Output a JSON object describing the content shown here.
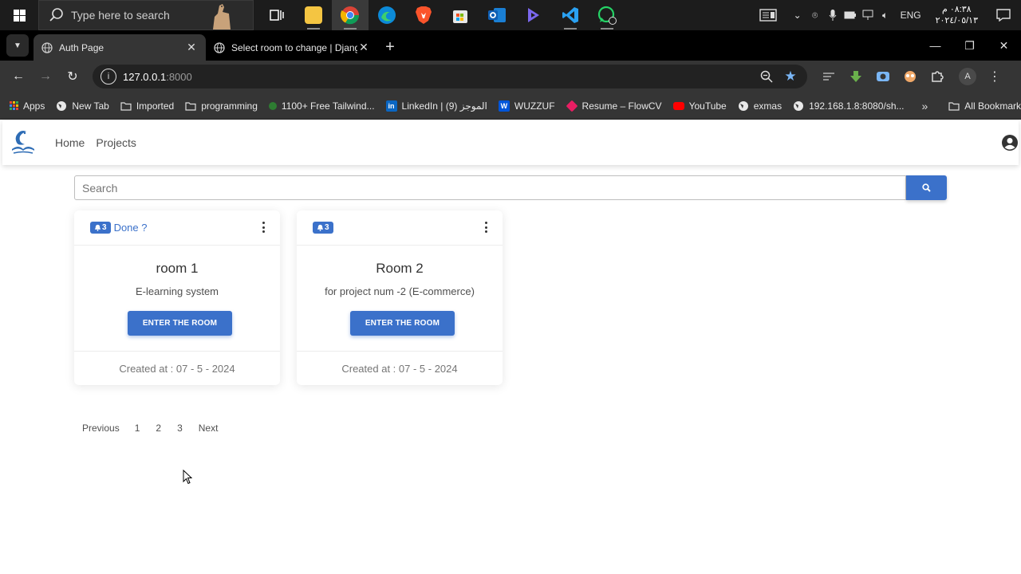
{
  "taskbar": {
    "search_placeholder": "Type here to search",
    "lang": "ENG",
    "time": "٠٨:٣٨ م",
    "date": "٢٠٢٤/٠٥/١٣"
  },
  "browser": {
    "tabs": [
      {
        "title": "Auth Page",
        "active": true
      },
      {
        "title": "Select room to change | Django",
        "active": false
      }
    ],
    "address": {
      "host": "127.0.0.1",
      "port": ":8000"
    },
    "profile_initial": "A",
    "bookmarks": [
      {
        "label": "Apps",
        "color": "#ea4335"
      },
      {
        "label": "New Tab",
        "color": "#e8e8e8"
      },
      {
        "label": "Imported",
        "color": "folder"
      },
      {
        "label": "programming",
        "color": "folder"
      },
      {
        "label": "1100+ Free Tailwind...",
        "color": "#2e7d32"
      },
      {
        "label": "LinkedIn | الموجز (9)",
        "color": "#0a66c2"
      },
      {
        "label": "WUZZUF",
        "color": "#0055d9"
      },
      {
        "label": "Resume – FlowCV",
        "color": "#e91e63"
      },
      {
        "label": "YouTube",
        "color": "#ff0000"
      },
      {
        "label": "exmas",
        "color": "#e8e8e8"
      },
      {
        "label": "192.168.1.8:8080/sh...",
        "color": "#e8e8e8"
      }
    ],
    "all_bookmarks": "All Bookmarks"
  },
  "navbar": {
    "links": [
      "Home",
      "Projects"
    ]
  },
  "search": {
    "placeholder": "Search"
  },
  "rooms": [
    {
      "badge": "3",
      "status": "Done ?",
      "title": "room 1",
      "description": "E-learning system",
      "button": "ENTER THE ROOM",
      "created": "Created at : 07 - 5 - 2024"
    },
    {
      "badge": "3",
      "status": "",
      "title": "Room 2",
      "description": "for project num -2 (E-commerce)",
      "button": "ENTER THE ROOM",
      "created": "Created at : 07 - 5 - 2024"
    }
  ],
  "pagination": {
    "previous": "Previous",
    "pages": [
      "1",
      "2",
      "3"
    ],
    "next": "Next"
  },
  "colors": {
    "primary": "#3b71ca"
  }
}
